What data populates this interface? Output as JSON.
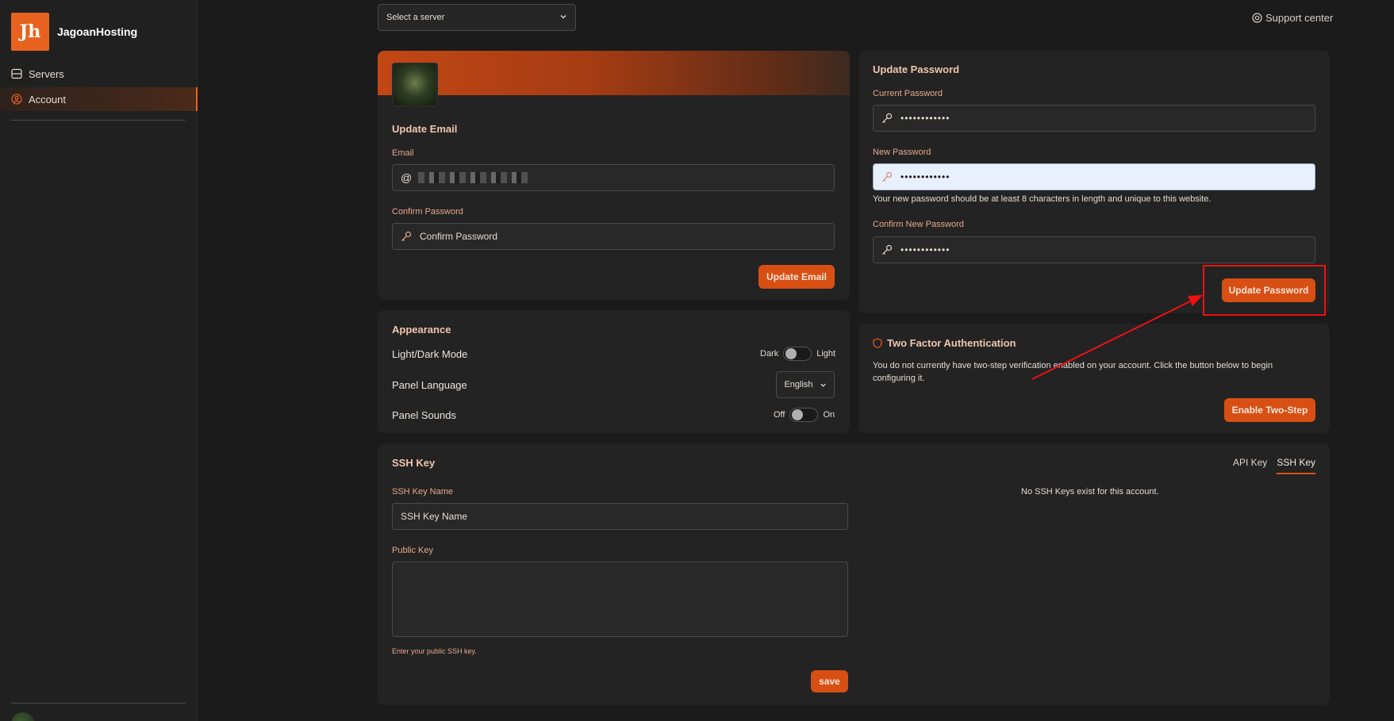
{
  "brand": {
    "logo_text": "Jh",
    "name": "JagoanHosting"
  },
  "sidebar": {
    "items": [
      {
        "label": "Servers"
      },
      {
        "label": "Account"
      }
    ]
  },
  "topbar": {
    "server_select": "Select a server",
    "support": "Support center"
  },
  "email_card": {
    "title": "Update Email",
    "email_label": "Email",
    "email_prefix": "@",
    "confirm_label": "Confirm Password",
    "confirm_placeholder": "Confirm Password",
    "button": "Update Email"
  },
  "password_card": {
    "title": "Update Password",
    "current_label": "Current Password",
    "current_value": "••••••••••••",
    "new_label": "New Password",
    "new_value": "••••••••••••",
    "hint": "Your new password should be at least 8 characters in length and unique to this website.",
    "confirm_label": "Confirm New Password",
    "confirm_value": "••••••••••••",
    "button": "Update Password"
  },
  "appearance_card": {
    "title": "Appearance",
    "mode_label": "Light/Dark Mode",
    "mode_left": "Dark",
    "mode_right": "Light",
    "language_label": "Panel Language",
    "language_value": "English",
    "sounds_label": "Panel Sounds",
    "sounds_left": "Off",
    "sounds_right": "On"
  },
  "tfa_card": {
    "title": "Two Factor Authentication",
    "text": "You do not currently have two-step verification enabled on your account. Click the button below to begin configuring it.",
    "button": "Enable Two-Step"
  },
  "ssh_card": {
    "title": "SSH Key",
    "tabs": [
      {
        "label": "API Key"
      },
      {
        "label": "SSH Key"
      }
    ],
    "name_label": "SSH Key Name",
    "name_placeholder": "SSH Key Name",
    "public_label": "Public Key",
    "public_hint": "Enter your public SSH key.",
    "save_button": "save",
    "empty_text": "No SSH Keys exist for this account."
  },
  "colors": {
    "accent": "#d84f14",
    "annotation": "#ee1111",
    "background": "#1b1b1b"
  }
}
